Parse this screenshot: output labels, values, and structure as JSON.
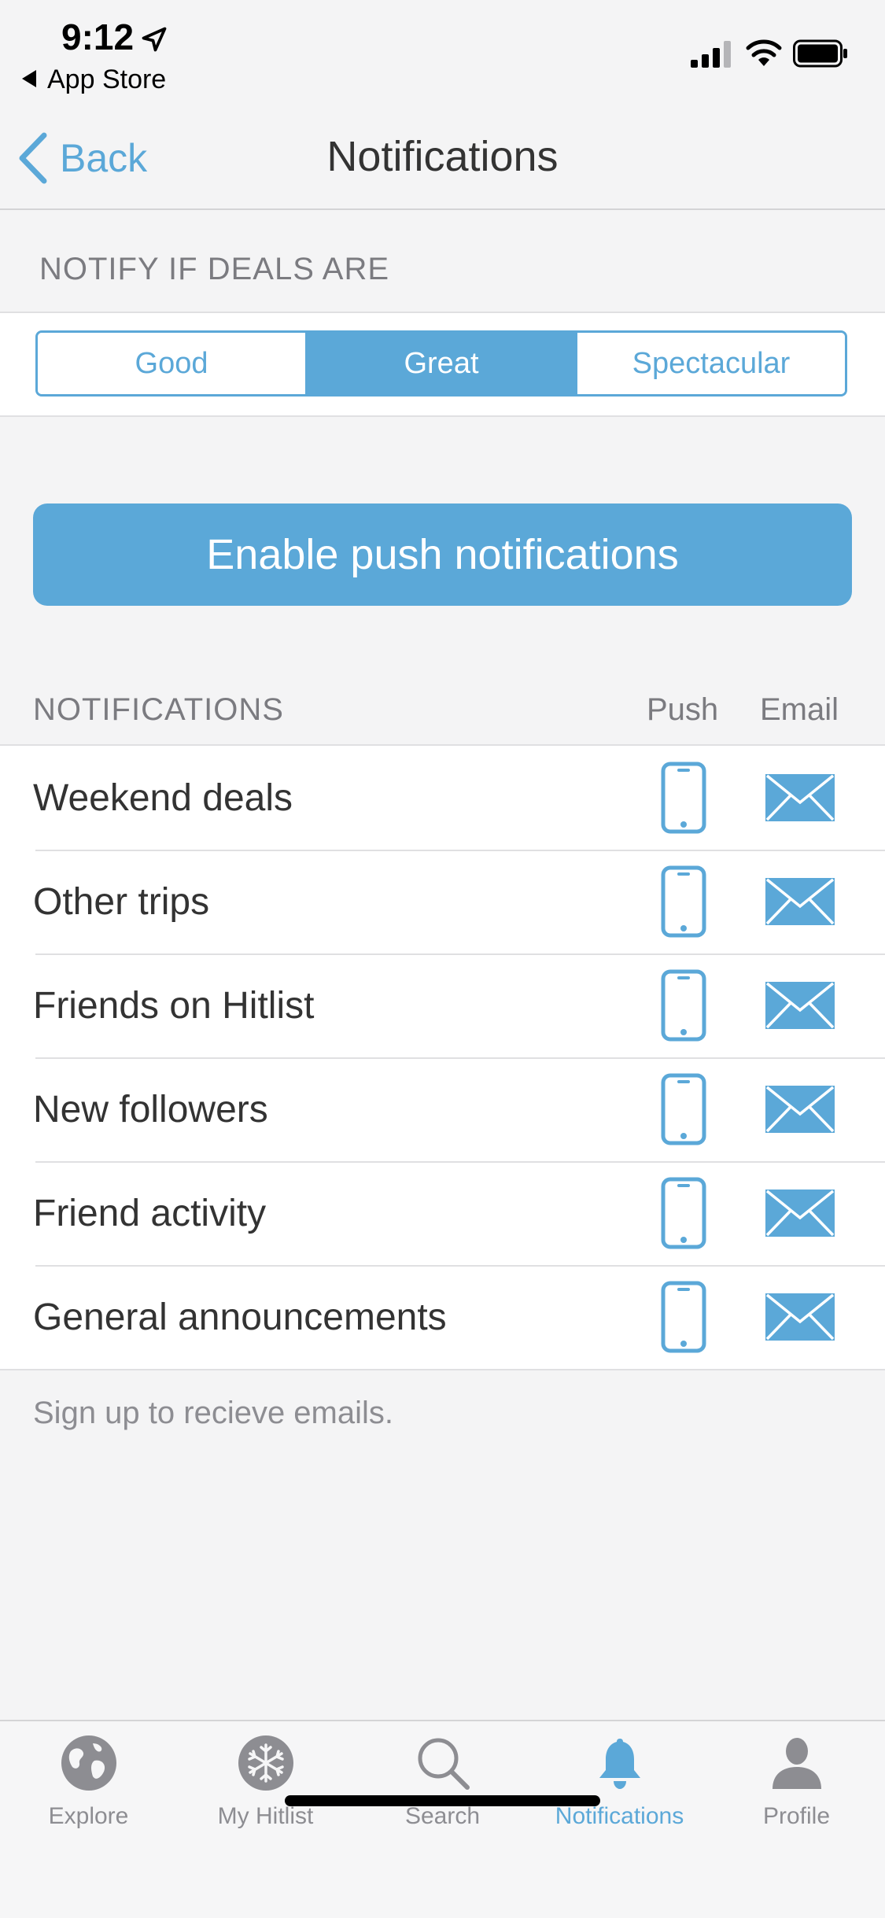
{
  "status_bar": {
    "time": "9:12",
    "back_app": "App Store"
  },
  "nav": {
    "back_label": "Back",
    "title": "Notifications"
  },
  "deal_filter": {
    "header": "NOTIFY IF DEALS ARE",
    "options": [
      "Good",
      "Great",
      "Spectacular"
    ],
    "selected": "Great"
  },
  "enable_push_label": "Enable push notifications",
  "notifications": {
    "header": "NOTIFICATIONS",
    "col_push": "Push",
    "col_email": "Email",
    "rows": [
      {
        "label": "Weekend deals"
      },
      {
        "label": "Other trips"
      },
      {
        "label": "Friends on Hitlist"
      },
      {
        "label": "New followers"
      },
      {
        "label": "Friend activity"
      },
      {
        "label": "General announcements"
      }
    ],
    "footer": "Sign up to recieve emails."
  },
  "tabs": [
    {
      "label": "Explore",
      "icon": "globe-icon"
    },
    {
      "label": "My Hitlist",
      "icon": "snowflake-icon"
    },
    {
      "label": "Search",
      "icon": "search-icon"
    },
    {
      "label": "Notifications",
      "icon": "bell-icon",
      "active": true
    },
    {
      "label": "Profile",
      "icon": "profile-icon"
    }
  ],
  "colors": {
    "accent": "#5ba8d8",
    "background": "#f4f4f5",
    "inactive_tab": "#8d8d92"
  }
}
